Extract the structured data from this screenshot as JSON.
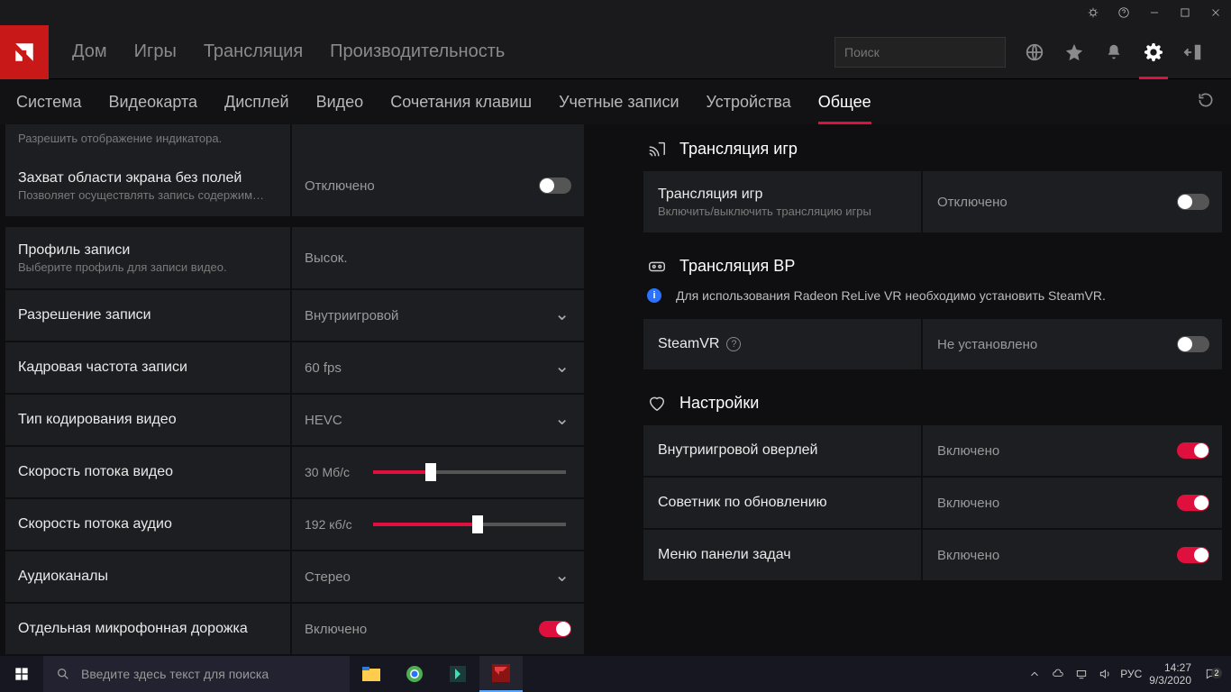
{
  "window": {
    "icons": [
      "bug-icon",
      "help-icon",
      "minimize-icon",
      "maximize-icon",
      "close-icon"
    ]
  },
  "mainnav": {
    "items": [
      "Дом",
      "Игры",
      "Трансляция",
      "Производительность"
    ],
    "search_placeholder": "Поиск"
  },
  "subnav": {
    "items": [
      "Система",
      "Видеокарта",
      "Дисплей",
      "Видео",
      "Сочетания клавиш",
      "Учетные записи",
      "Устройства",
      "Общее"
    ],
    "active_index": 7
  },
  "left": {
    "partial_top": {
      "sub": "Разрешить отображение индикатора."
    },
    "row0": {
      "title": "Захват области экрана без полей",
      "sub": "Позволяет осуществлять запись содержим…",
      "value": "Отключено",
      "on": false
    },
    "profile": {
      "title": "Профиль записи",
      "sub": "Выберите профиль для записи видео.",
      "value": "Высок."
    },
    "resolution": {
      "title": "Разрешение записи",
      "value": "Внутриигровой"
    },
    "fps": {
      "title": "Кадровая частота записи",
      "value": "60 fps"
    },
    "codec": {
      "title": "Тип кодирования видео",
      "value": "HEVC"
    },
    "vbr": {
      "title": "Скорость потока видео",
      "value": "30 Мб/с",
      "pct": 30
    },
    "abr": {
      "title": "Скорость потока аудио",
      "value": "192 кб/с",
      "pct": 54
    },
    "channels": {
      "title": "Аудиоканалы",
      "value": "Стерео"
    },
    "mic": {
      "title": "Отдельная микрофонная дорожка",
      "value": "Включено",
      "on": true
    }
  },
  "right": {
    "sect1": "Трансляция игр",
    "stream": {
      "title": "Трансляция игр",
      "sub": "Включить/выключить трансляцию игры",
      "value": "Отключено",
      "on": false
    },
    "sect2": "Трансляция ВР",
    "vr_info": "Для использования Radeon ReLive VR необходимо установить SteamVR.",
    "steamvr": {
      "title": "SteamVR",
      "value": "Не установлено",
      "on": false
    },
    "sect3": "Настройки",
    "overlay": {
      "title": "Внутриигровой оверлей",
      "value": "Включено",
      "on": true
    },
    "advisor": {
      "title": "Советник по обновлению",
      "value": "Включено",
      "on": true
    },
    "tray": {
      "title": "Меню панели задач",
      "value": "Включено",
      "on": true
    }
  },
  "taskbar": {
    "search_placeholder": "Введите здесь текст для поиска",
    "lang": "РУС",
    "time": "14:27",
    "date": "9/3/2020",
    "notif_count": "2"
  }
}
